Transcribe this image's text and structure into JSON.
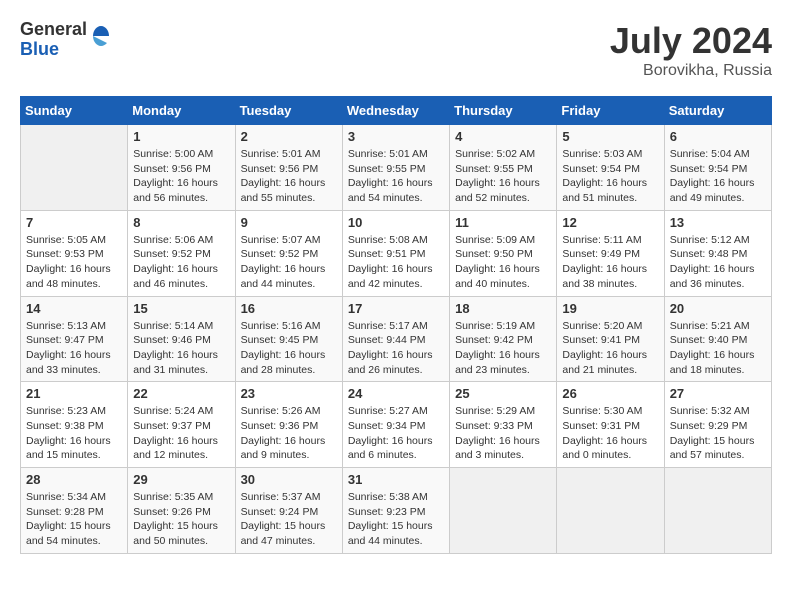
{
  "header": {
    "logo_general": "General",
    "logo_blue": "Blue",
    "month_year": "July 2024",
    "location": "Borovikha, Russia"
  },
  "days_of_week": [
    "Sunday",
    "Monday",
    "Tuesday",
    "Wednesday",
    "Thursday",
    "Friday",
    "Saturday"
  ],
  "weeks": [
    [
      {
        "day": "",
        "info": ""
      },
      {
        "day": "1",
        "info": "Sunrise: 5:00 AM\nSunset: 9:56 PM\nDaylight: 16 hours\nand 56 minutes."
      },
      {
        "day": "2",
        "info": "Sunrise: 5:01 AM\nSunset: 9:56 PM\nDaylight: 16 hours\nand 55 minutes."
      },
      {
        "day": "3",
        "info": "Sunrise: 5:01 AM\nSunset: 9:55 PM\nDaylight: 16 hours\nand 54 minutes."
      },
      {
        "day": "4",
        "info": "Sunrise: 5:02 AM\nSunset: 9:55 PM\nDaylight: 16 hours\nand 52 minutes."
      },
      {
        "day": "5",
        "info": "Sunrise: 5:03 AM\nSunset: 9:54 PM\nDaylight: 16 hours\nand 51 minutes."
      },
      {
        "day": "6",
        "info": "Sunrise: 5:04 AM\nSunset: 9:54 PM\nDaylight: 16 hours\nand 49 minutes."
      }
    ],
    [
      {
        "day": "7",
        "info": "Sunrise: 5:05 AM\nSunset: 9:53 PM\nDaylight: 16 hours\nand 48 minutes."
      },
      {
        "day": "8",
        "info": "Sunrise: 5:06 AM\nSunset: 9:52 PM\nDaylight: 16 hours\nand 46 minutes."
      },
      {
        "day": "9",
        "info": "Sunrise: 5:07 AM\nSunset: 9:52 PM\nDaylight: 16 hours\nand 44 minutes."
      },
      {
        "day": "10",
        "info": "Sunrise: 5:08 AM\nSunset: 9:51 PM\nDaylight: 16 hours\nand 42 minutes."
      },
      {
        "day": "11",
        "info": "Sunrise: 5:09 AM\nSunset: 9:50 PM\nDaylight: 16 hours\nand 40 minutes."
      },
      {
        "day": "12",
        "info": "Sunrise: 5:11 AM\nSunset: 9:49 PM\nDaylight: 16 hours\nand 38 minutes."
      },
      {
        "day": "13",
        "info": "Sunrise: 5:12 AM\nSunset: 9:48 PM\nDaylight: 16 hours\nand 36 minutes."
      }
    ],
    [
      {
        "day": "14",
        "info": "Sunrise: 5:13 AM\nSunset: 9:47 PM\nDaylight: 16 hours\nand 33 minutes."
      },
      {
        "day": "15",
        "info": "Sunrise: 5:14 AM\nSunset: 9:46 PM\nDaylight: 16 hours\nand 31 minutes."
      },
      {
        "day": "16",
        "info": "Sunrise: 5:16 AM\nSunset: 9:45 PM\nDaylight: 16 hours\nand 28 minutes."
      },
      {
        "day": "17",
        "info": "Sunrise: 5:17 AM\nSunset: 9:44 PM\nDaylight: 16 hours\nand 26 minutes."
      },
      {
        "day": "18",
        "info": "Sunrise: 5:19 AM\nSunset: 9:42 PM\nDaylight: 16 hours\nand 23 minutes."
      },
      {
        "day": "19",
        "info": "Sunrise: 5:20 AM\nSunset: 9:41 PM\nDaylight: 16 hours\nand 21 minutes."
      },
      {
        "day": "20",
        "info": "Sunrise: 5:21 AM\nSunset: 9:40 PM\nDaylight: 16 hours\nand 18 minutes."
      }
    ],
    [
      {
        "day": "21",
        "info": "Sunrise: 5:23 AM\nSunset: 9:38 PM\nDaylight: 16 hours\nand 15 minutes."
      },
      {
        "day": "22",
        "info": "Sunrise: 5:24 AM\nSunset: 9:37 PM\nDaylight: 16 hours\nand 12 minutes."
      },
      {
        "day": "23",
        "info": "Sunrise: 5:26 AM\nSunset: 9:36 PM\nDaylight: 16 hours\nand 9 minutes."
      },
      {
        "day": "24",
        "info": "Sunrise: 5:27 AM\nSunset: 9:34 PM\nDaylight: 16 hours\nand 6 minutes."
      },
      {
        "day": "25",
        "info": "Sunrise: 5:29 AM\nSunset: 9:33 PM\nDaylight: 16 hours\nand 3 minutes."
      },
      {
        "day": "26",
        "info": "Sunrise: 5:30 AM\nSunset: 9:31 PM\nDaylight: 16 hours\nand 0 minutes."
      },
      {
        "day": "27",
        "info": "Sunrise: 5:32 AM\nSunset: 9:29 PM\nDaylight: 15 hours\nand 57 minutes."
      }
    ],
    [
      {
        "day": "28",
        "info": "Sunrise: 5:34 AM\nSunset: 9:28 PM\nDaylight: 15 hours\nand 54 minutes."
      },
      {
        "day": "29",
        "info": "Sunrise: 5:35 AM\nSunset: 9:26 PM\nDaylight: 15 hours\nand 50 minutes."
      },
      {
        "day": "30",
        "info": "Sunrise: 5:37 AM\nSunset: 9:24 PM\nDaylight: 15 hours\nand 47 minutes."
      },
      {
        "day": "31",
        "info": "Sunrise: 5:38 AM\nSunset: 9:23 PM\nDaylight: 15 hours\nand 44 minutes."
      },
      {
        "day": "",
        "info": ""
      },
      {
        "day": "",
        "info": ""
      },
      {
        "day": "",
        "info": ""
      }
    ]
  ]
}
